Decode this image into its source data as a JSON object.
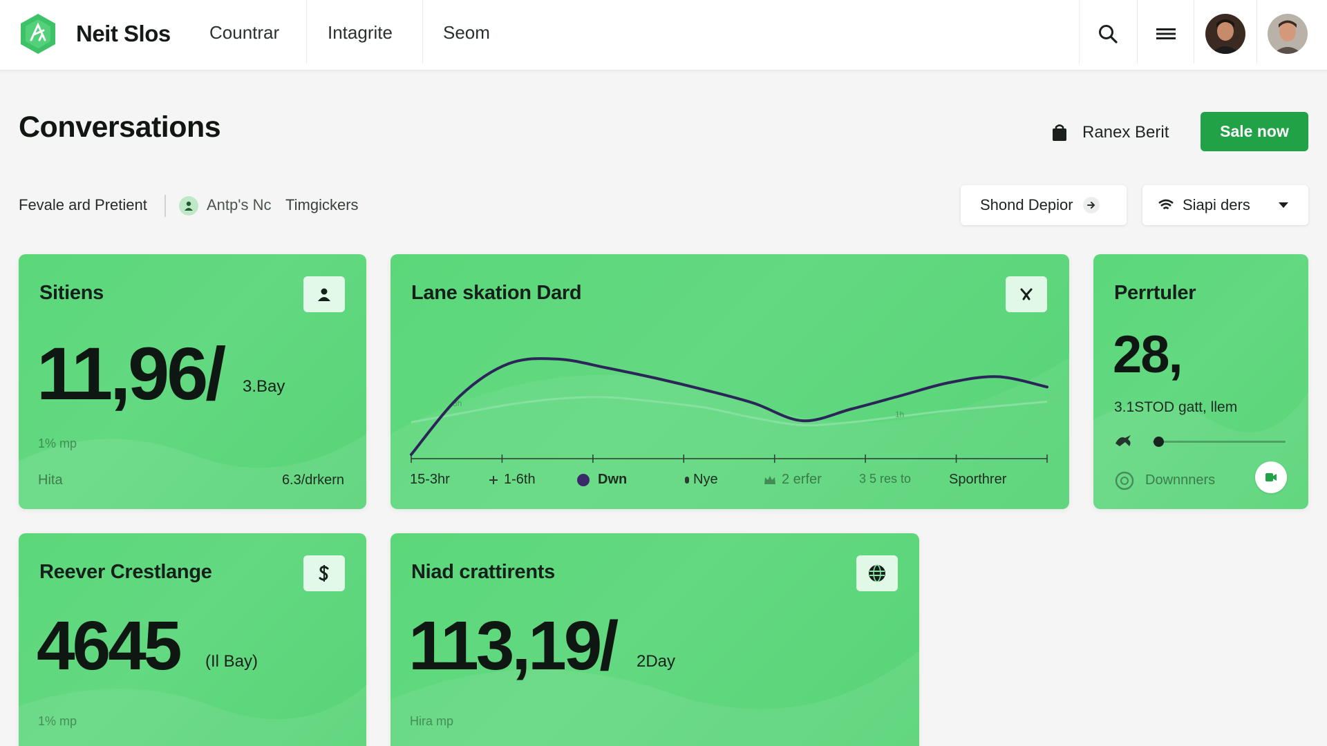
{
  "brand": {
    "name": "Neit Slos"
  },
  "nav": {
    "items": [
      "Countrar",
      "Intagrite",
      "Seom"
    ]
  },
  "header": {
    "title": "Conversations",
    "owner_label": "Ranex Berit",
    "cta_label": "Sale now"
  },
  "filters": {
    "left_label": "Fevale ard Pretient",
    "chip_label": "Antp's Nc",
    "chip_secondary": "Timgickers",
    "button1_label": "Shond Depior",
    "button2_label": "Siapi ders"
  },
  "cards": {
    "sitiens": {
      "title": "Sitiens",
      "value": "11,96/",
      "unit": "3.Bay",
      "note": "1% mp",
      "foot_left": "Hita",
      "foot_right": "6.3/drkern"
    },
    "lane": {
      "title": "Lane skation Dard",
      "legend": [
        "15-3hr",
        "1-6th",
        "Dwn",
        "Nye",
        "2 erfer",
        "3 5 res to",
        "Sporthrer"
      ],
      "faint_marks": [
        "3h",
        "1h"
      ]
    },
    "perrtuler": {
      "title": "Perrtuler",
      "value": "28,",
      "subtitle": "3.1STOD gatt, llem",
      "slider_fraction": 0.04,
      "foot_label": "Downnners"
    },
    "reever": {
      "title": "Reever Crestlange",
      "value": "4645",
      "unit": "(Il Bay)",
      "note": "1% mp"
    },
    "niad": {
      "title": "Niad crattirents",
      "value": "113,19/",
      "unit": "2Day",
      "note": "Hira mp"
    }
  },
  "chart_data": {
    "type": "line",
    "title": "Lane skation Dard",
    "series": [
      {
        "values": [
          0,
          40,
          62,
          65,
          59,
          52,
          44,
          35,
          23,
          31,
          40,
          49,
          53,
          46
        ]
      },
      {
        "values": [
          22,
          28,
          34,
          38,
          39,
          36,
          32,
          25,
          20,
          22,
          26,
          30,
          33,
          36
        ]
      }
    ],
    "ylim": [
      0,
      80
    ],
    "grid": false,
    "legend": "bottom"
  },
  "colors": {
    "accent": "#22a246",
    "card_green": "#5fd87d",
    "line_dark": "#2b2558",
    "line_light": "#86e0a0",
    "legend_dot": "#3b2a6a"
  },
  "icons": [
    "logo-icon",
    "search-icon",
    "menu-icon",
    "bag-icon",
    "arrow-right-icon",
    "wifi-icon",
    "chevron-down-icon",
    "user-icon",
    "tool-icon",
    "dollar-icon",
    "globe-icon",
    "chat-icon",
    "circle-icon",
    "bird-icon"
  ]
}
